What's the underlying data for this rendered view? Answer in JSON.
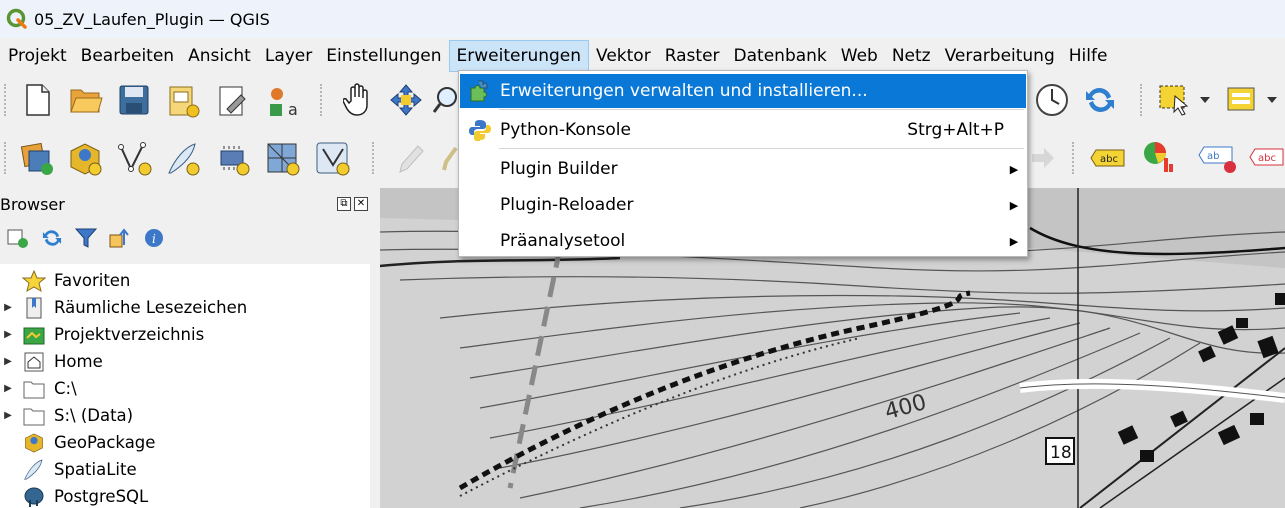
{
  "window": {
    "title": "05_ZV_Laufen_Plugin — QGIS"
  },
  "menubar": [
    {
      "label": "Projekt"
    },
    {
      "label": "Bearbeiten"
    },
    {
      "label": "Ansicht"
    },
    {
      "label": "Layer"
    },
    {
      "label": "Einstellungen"
    },
    {
      "label": "Erweiterungen"
    },
    {
      "label": "Vektor"
    },
    {
      "label": "Raster"
    },
    {
      "label": "Datenbank"
    },
    {
      "label": "Web"
    },
    {
      "label": "Netz"
    },
    {
      "label": "Verarbeitung"
    },
    {
      "label": "Hilfe"
    }
  ],
  "active_menu": "Erweiterungen",
  "dropdown": {
    "items": [
      {
        "label": "Erweiterungen verwalten und installieren...",
        "icon": "puzzle-icon",
        "highlighted": true
      },
      {
        "label": "Python-Konsole",
        "shortcut": "Strg+Alt+P",
        "icon": "python-icon"
      },
      {
        "label": "Plugin Builder",
        "submenu": true
      },
      {
        "label": "Plugin-Reloader",
        "submenu": true
      },
      {
        "label": "Präanalysetool",
        "submenu": true
      }
    ]
  },
  "browser": {
    "title": "Browser",
    "items": [
      {
        "label": "Favoriten",
        "icon": "star-icon",
        "expandable": false
      },
      {
        "label": "Räumliche Lesezeichen",
        "icon": "bookmark-icon",
        "expandable": true
      },
      {
        "label": "Projektverzeichnis",
        "icon": "project-folder-icon",
        "expandable": true
      },
      {
        "label": "Home",
        "icon": "home-icon",
        "expandable": true
      },
      {
        "label": "C:\\",
        "icon": "folder-icon",
        "expandable": true
      },
      {
        "label": "S:\\ (Data)",
        "icon": "folder-icon",
        "expandable": true
      },
      {
        "label": "GeoPackage",
        "icon": "geopackage-icon",
        "expandable": false
      },
      {
        "label": "SpatiaLite",
        "icon": "spatialite-icon",
        "expandable": false
      },
      {
        "label": "PostgreSQL",
        "icon": "postgresql-icon",
        "expandable": false
      }
    ]
  },
  "map": {
    "contour_label": "400",
    "road_number": "18"
  },
  "colors": {
    "accent": "#0a78d7",
    "menu_active_bg": "#cce4f7",
    "titlebar_bg": "#eef2fa"
  }
}
